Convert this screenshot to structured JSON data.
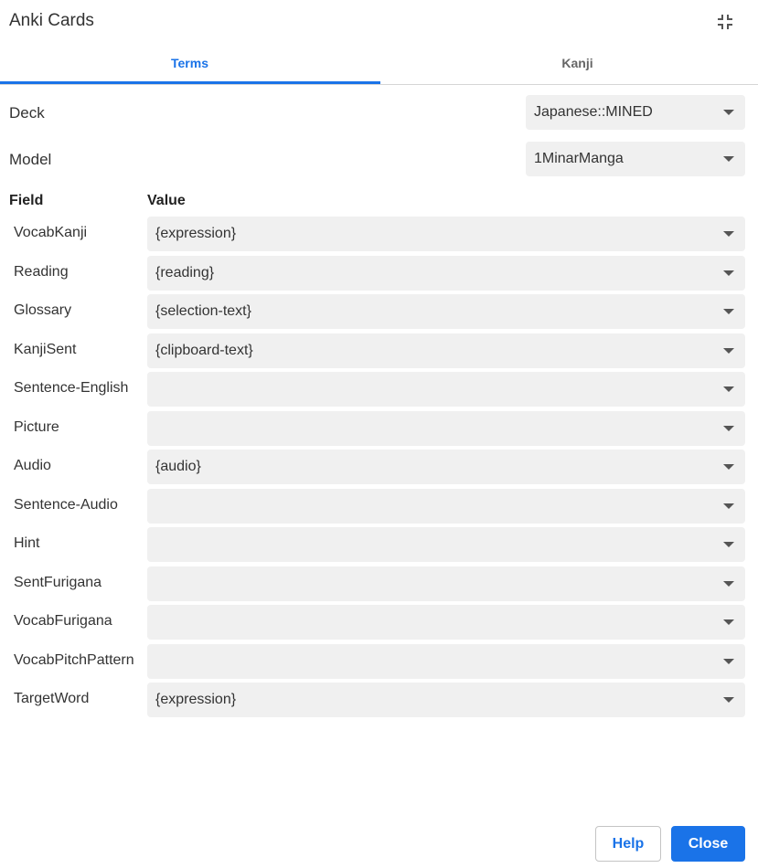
{
  "dialog": {
    "title": "Anki Cards",
    "collapse_icon": "collapse-icon"
  },
  "tabs": [
    {
      "label": "Terms",
      "active": true
    },
    {
      "label": "Kanji",
      "active": false
    }
  ],
  "deck": {
    "label": "Deck",
    "value": "Japanese::MINED"
  },
  "model": {
    "label": "Model",
    "value": "1MinarManga"
  },
  "fields_table": {
    "header_field": "Field",
    "header_value": "Value",
    "rows": [
      {
        "name": "VocabKanji",
        "value": "{expression}"
      },
      {
        "name": "Reading",
        "value": "{reading}"
      },
      {
        "name": "Glossary",
        "value": "{selection-text}"
      },
      {
        "name": "KanjiSent",
        "value": "{clipboard-text}"
      },
      {
        "name": "Sentence-English",
        "value": ""
      },
      {
        "name": "Picture",
        "value": ""
      },
      {
        "name": "Audio",
        "value": "{audio}"
      },
      {
        "name": "Sentence-Audio",
        "value": ""
      },
      {
        "name": "Hint",
        "value": ""
      },
      {
        "name": "SentFurigana",
        "value": ""
      },
      {
        "name": "VocabFurigana",
        "value": ""
      },
      {
        "name": "VocabPitchPattern",
        "value": ""
      },
      {
        "name": "TargetWord",
        "value": "{expression}"
      }
    ]
  },
  "footer": {
    "help_label": "Help",
    "close_label": "Close"
  },
  "colors": {
    "accent": "#1a73e8",
    "select_bg": "#f0f0f0"
  }
}
